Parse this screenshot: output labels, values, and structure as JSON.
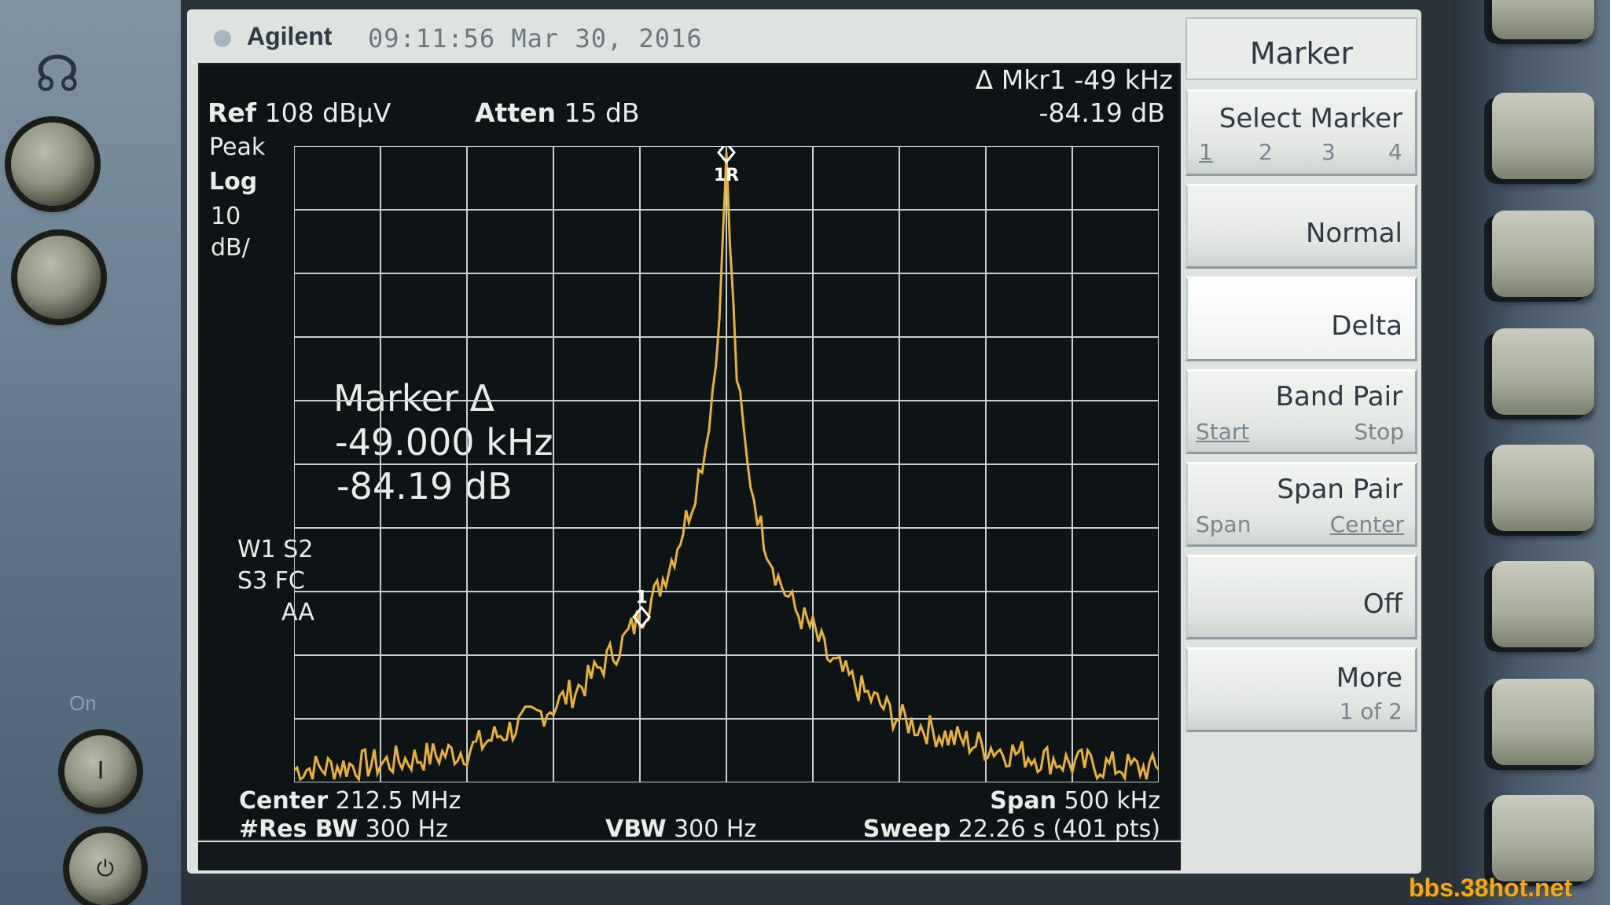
{
  "header": {
    "brand": "Agilent",
    "timestamp": "09:11:56  Mar 30, 2016"
  },
  "display": {
    "ref_label": "Ref",
    "ref_value": "108 dBµV",
    "atten_label": "Atten",
    "atten_value": "15 dB",
    "marker_header_line1": "Δ Mkr1  -49 kHz",
    "marker_header_line2": "-84.19 dB",
    "detector": "Peak",
    "scale_type": "Log",
    "scale_value": "10",
    "scale_unit": "dB/",
    "marker_box_title": "Marker Δ",
    "marker_box_freq": "-49.000 kHz",
    "marker_box_ampl": "-84.19 dB",
    "trace_flags_1": "W1  S2",
    "trace_flags_2": "S3  FC",
    "trace_flags_3": "AA",
    "center_label": "Center",
    "center_value": "212.5 MHz",
    "span_label": "Span",
    "span_value": "500 kHz",
    "rbw_label": "#Res BW",
    "rbw_value": "300 Hz",
    "vbw_label": "VBW",
    "vbw_value": "300 Hz",
    "sweep_label": "Sweep",
    "sweep_value": "22.26 s (401 pts)",
    "marker_ref_tag": "1R",
    "marker_delta_tag": "1"
  },
  "chart_data": {
    "type": "line",
    "x_unit": "kHz offset from center",
    "xlim": [
      -250,
      250
    ],
    "ylim": [
      0,
      10
    ],
    "grid": true,
    "grid_divisions": {
      "x": 10,
      "y": 10
    },
    "series": [
      {
        "color": "#e8b23a",
        "points": [
          [
            -250,
            0.2
          ],
          [
            -200,
            0.3
          ],
          [
            -150,
            0.5
          ],
          [
            -120,
            0.9
          ],
          [
            -100,
            1.2
          ],
          [
            -80,
            1.6
          ],
          [
            -60,
            2.2
          ],
          [
            -50,
            2.6
          ],
          [
            -40,
            3.0
          ],
          [
            -30,
            3.6
          ],
          [
            -20,
            4.4
          ],
          [
            -12,
            5.3
          ],
          [
            -6,
            6.6
          ],
          [
            -2,
            8.5
          ],
          [
            0,
            9.9
          ],
          [
            2,
            8.5
          ],
          [
            6,
            6.4
          ],
          [
            12,
            5.0
          ],
          [
            20,
            4.0
          ],
          [
            30,
            3.2
          ],
          [
            40,
            2.7
          ],
          [
            50,
            2.4
          ],
          [
            60,
            1.9
          ],
          [
            80,
            1.4
          ],
          [
            100,
            1.0
          ],
          [
            130,
            0.7
          ],
          [
            160,
            0.5
          ],
          [
            200,
            0.3
          ],
          [
            250,
            0.2
          ]
        ]
      }
    ],
    "markers": [
      {
        "label": "1R",
        "x": 0,
        "y": 9.9
      },
      {
        "label": "1",
        "x": -49,
        "y": 2.6
      }
    ]
  },
  "softkeys": {
    "title": "Marker",
    "select_marker": "Select Marker",
    "select_marker_options": [
      "1",
      "2",
      "3",
      "4"
    ],
    "normal": "Normal",
    "delta": "Delta",
    "band_pair": "Band Pair",
    "band_pair_start": "Start",
    "band_pair_stop": "Stop",
    "span_pair": "Span Pair",
    "span_pair_span": "Span",
    "span_pair_center": "Center",
    "off": "Off",
    "more": "More",
    "more_page": "1 of 2"
  },
  "front_panel": {
    "on_label": "On",
    "power_on_symbol": "I",
    "power_standby_symbol": "⏻"
  },
  "watermark": "bbs.38hot.net"
}
